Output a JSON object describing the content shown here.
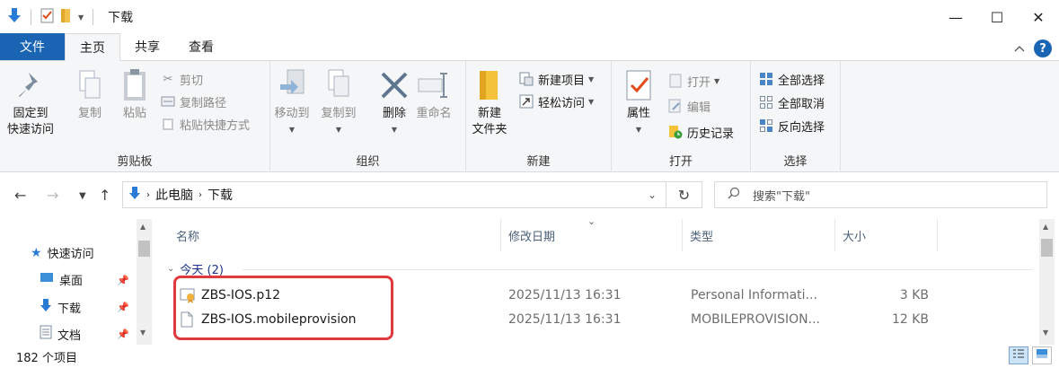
{
  "window": {
    "title": "下载",
    "minimize": "—",
    "maximize": "☐",
    "close": "✕"
  },
  "ribbon_tabs": [
    "文件",
    "主页",
    "共享",
    "查看"
  ],
  "ribbon": {
    "clipboard": {
      "label": "剪贴板",
      "pin_line1": "固定到",
      "pin_line2": "快速访问",
      "copy": "复制",
      "paste": "粘贴",
      "cut": "剪切",
      "copy_path": "复制路径",
      "paste_shortcut": "粘贴快捷方式"
    },
    "organize": {
      "label": "组织",
      "move_to": "移动到",
      "copy_to": "复制到",
      "delete": "删除",
      "rename": "重命名"
    },
    "new": {
      "label": "新建",
      "new_item": "新建项目",
      "easy_access": "轻松访问",
      "new_folder_line1": "新建",
      "new_folder_line2": "文件夹"
    },
    "open": {
      "label": "打开",
      "properties": "属性",
      "open": "打开",
      "edit": "编辑",
      "history": "历史记录"
    },
    "select": {
      "label": "选择",
      "select_all": "全部选择",
      "select_none": "全部取消",
      "invert": "反向选择"
    }
  },
  "address": {
    "crumbs": [
      "此电脑",
      "下载"
    ],
    "search_placeholder": "搜索\"下载\""
  },
  "nav_pane": {
    "items": [
      {
        "label": "快速访问"
      },
      {
        "label": "桌面"
      },
      {
        "label": "下载"
      },
      {
        "label": "文档"
      }
    ]
  },
  "columns": [
    "名称",
    "修改日期",
    "类型",
    "大小"
  ],
  "group": {
    "label": "今天 (2)"
  },
  "files": [
    {
      "name": "ZBS-IOS.p12",
      "date": "2025/11/13 16:31",
      "type": "Personal Informati...",
      "size": "3 KB"
    },
    {
      "name": "ZBS-IOS.mobileprovision",
      "date": "2025/11/13 16:31",
      "type": "MOBILEPROVISION...",
      "size": "12 KB"
    }
  ],
  "status": {
    "item_count": "182 个项目"
  },
  "colors": {
    "file_tab": "#1a64b4",
    "highlight": "#e0393e",
    "group_header": "#1e3287"
  }
}
